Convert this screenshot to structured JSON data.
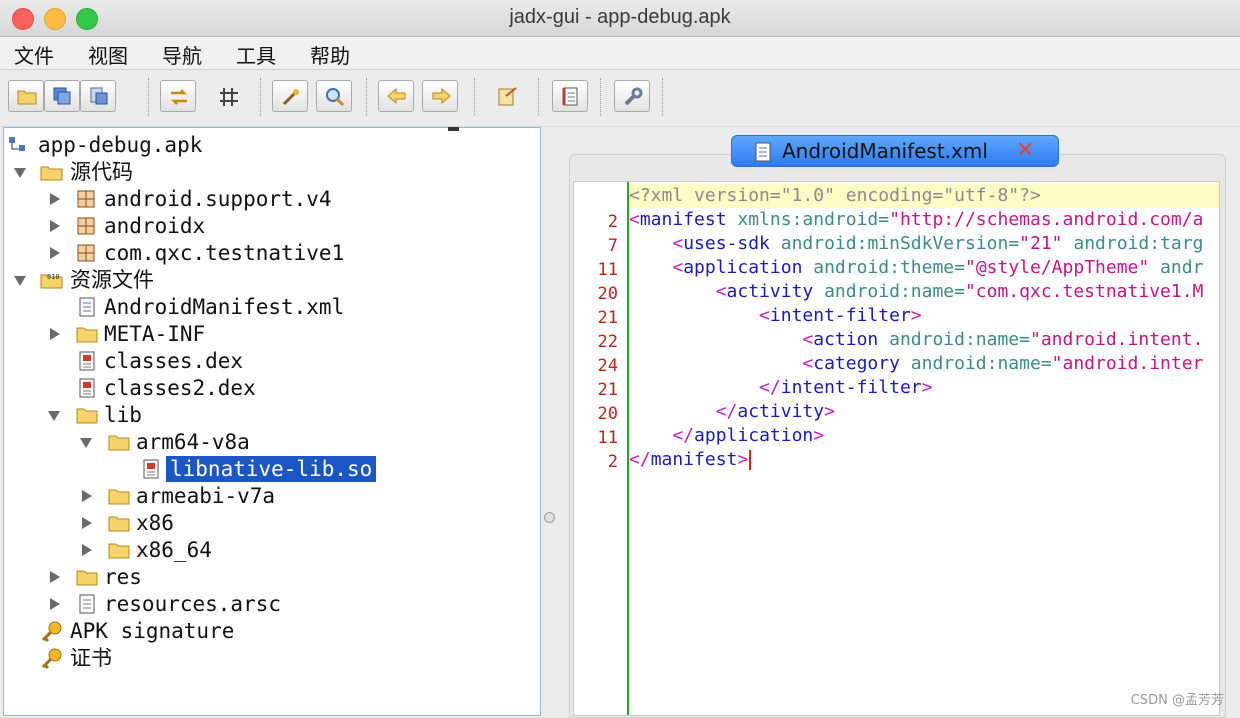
{
  "window": {
    "title": "jadx-gui - app-debug.apk"
  },
  "menu": [
    "文件",
    "视图",
    "导航",
    "工具",
    "帮助"
  ],
  "tree": {
    "root": "app-debug.apk",
    "source_code": "源代码",
    "packages": [
      "android.support.v4",
      "androidx",
      "com.qxc.testnative1"
    ],
    "resources": "资源文件",
    "manifest": "AndroidManifest.xml",
    "meta_inf": "META-INF",
    "classes": "classes.dex",
    "classes2": "classes2.dex",
    "lib": "lib",
    "arm64": "arm64-v8a",
    "libnative": "libnative-lib.so",
    "armeabi": "armeabi-v7a",
    "x86": "x86",
    "x86_64": "x86_64",
    "res": "res",
    "resources_arsc": "resources.arsc",
    "apk_signature": "APK signature",
    "certificate": "证书"
  },
  "editor": {
    "tab_label": "AndroidManifest.xml",
    "line_numbers": [
      "",
      "2",
      "7",
      "11",
      "20",
      "21",
      "22",
      "24",
      "21",
      "20",
      "11",
      "2"
    ],
    "lines": [
      [
        {
          "c": "decl",
          "t": "<?xml version=\"1.0\" encoding=\"utf-8\"?>"
        }
      ],
      [
        {
          "c": "br",
          "t": "<"
        },
        {
          "c": "tag",
          "t": "manifest"
        },
        {
          "c": "attr",
          "t": " xmlns:android="
        },
        {
          "c": "val",
          "t": "\"http://schemas.android.com/a"
        }
      ],
      [
        {
          "c": "plain",
          "t": "    "
        },
        {
          "c": "br",
          "t": "<"
        },
        {
          "c": "tag",
          "t": "uses-sdk"
        },
        {
          "c": "attr",
          "t": " android:minSdkVersion="
        },
        {
          "c": "val",
          "t": "\"21\""
        },
        {
          "c": "attr",
          "t": " android:targ"
        }
      ],
      [
        {
          "c": "plain",
          "t": "    "
        },
        {
          "c": "br",
          "t": "<"
        },
        {
          "c": "tag",
          "t": "application"
        },
        {
          "c": "attr",
          "t": " android:theme="
        },
        {
          "c": "val",
          "t": "\"@style/AppTheme\""
        },
        {
          "c": "attr",
          "t": " andr"
        }
      ],
      [
        {
          "c": "plain",
          "t": "        "
        },
        {
          "c": "br",
          "t": "<"
        },
        {
          "c": "tag",
          "t": "activity"
        },
        {
          "c": "attr",
          "t": " android:name="
        },
        {
          "c": "val",
          "t": "\"com.qxc.testnative1.M"
        }
      ],
      [
        {
          "c": "plain",
          "t": "            "
        },
        {
          "c": "br",
          "t": "<"
        },
        {
          "c": "tag",
          "t": "intent-filter"
        },
        {
          "c": "br",
          "t": ">"
        }
      ],
      [
        {
          "c": "plain",
          "t": "                "
        },
        {
          "c": "br",
          "t": "<"
        },
        {
          "c": "tag",
          "t": "action"
        },
        {
          "c": "attr",
          "t": " android:name="
        },
        {
          "c": "val",
          "t": "\"android.intent."
        }
      ],
      [
        {
          "c": "plain",
          "t": "                "
        },
        {
          "c": "br",
          "t": "<"
        },
        {
          "c": "tag",
          "t": "category"
        },
        {
          "c": "attr",
          "t": " android:name="
        },
        {
          "c": "val",
          "t": "\"android.inter"
        }
      ],
      [
        {
          "c": "plain",
          "t": "            "
        },
        {
          "c": "br",
          "t": "</"
        },
        {
          "c": "tag",
          "t": "intent-filter"
        },
        {
          "c": "br",
          "t": ">"
        }
      ],
      [
        {
          "c": "plain",
          "t": "        "
        },
        {
          "c": "br",
          "t": "</"
        },
        {
          "c": "tag",
          "t": "activity"
        },
        {
          "c": "br",
          "t": ">"
        }
      ],
      [
        {
          "c": "plain",
          "t": "    "
        },
        {
          "c": "br",
          "t": "</"
        },
        {
          "c": "tag",
          "t": "application"
        },
        {
          "c": "br",
          "t": ">"
        }
      ],
      [
        {
          "c": "br",
          "t": "</"
        },
        {
          "c": "tag",
          "t": "manifest"
        },
        {
          "c": "br",
          "t": ">"
        }
      ]
    ]
  },
  "watermark": "CSDN @孟芳芳"
}
